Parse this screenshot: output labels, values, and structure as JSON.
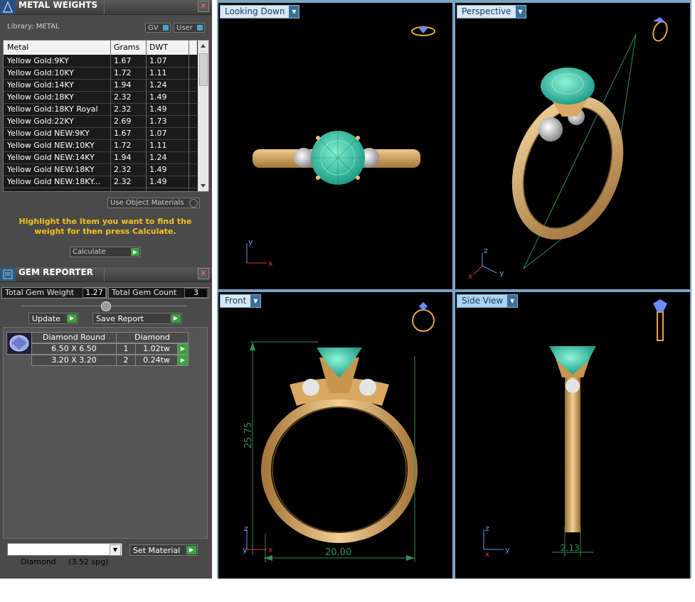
{
  "metal_panel": {
    "title": "METAL WEIGHTS",
    "library_label": "Library: METAL",
    "gv_label": "GV",
    "user_label": "User",
    "columns": [
      "Metal",
      "Grams",
      "DWT"
    ],
    "rows": [
      {
        "metal": "Yellow Gold:9KY",
        "grams": "1.67",
        "dwt": "1.07"
      },
      {
        "metal": "Yellow Gold:10KY",
        "grams": "1.72",
        "dwt": "1.11"
      },
      {
        "metal": "Yellow Gold:14KY",
        "grams": "1.94",
        "dwt": "1.24"
      },
      {
        "metal": "Yellow Gold:18KY",
        "grams": "2.32",
        "dwt": "1.49"
      },
      {
        "metal": "Yellow Gold:18KY Royal",
        "grams": "2.32",
        "dwt": "1.49"
      },
      {
        "metal": "Yellow Gold:22KY",
        "grams": "2.69",
        "dwt": "1.73"
      },
      {
        "metal": "Yellow Gold NEW:9KY",
        "grams": "1.67",
        "dwt": "1.07"
      },
      {
        "metal": "Yellow Gold NEW:10KY",
        "grams": "1.72",
        "dwt": "1.11"
      },
      {
        "metal": "Yellow Gold NEW:14KY",
        "grams": "1.94",
        "dwt": "1.24"
      },
      {
        "metal": "Yellow Gold NEW:18KY",
        "grams": "2.32",
        "dwt": "1.49"
      },
      {
        "metal": "Yellow Gold NEW:18KY...",
        "grams": "2.32",
        "dwt": "1.49"
      }
    ],
    "use_object_materials": "Use Object Materials",
    "hint": "Highlight the item you want to find the weight for then press Calculate.",
    "calculate_label": "Calculate"
  },
  "gem_panel": {
    "title": "GEM REPORTER",
    "total_weight_label": "Total Gem Weight",
    "total_weight_value": "1.27",
    "total_count_label": "Total Gem Count",
    "total_count_value": "3",
    "update_label": "Update",
    "save_report_label": "Save Report",
    "group_name": "Diamond Round",
    "group_material": "Diamond",
    "gems": [
      {
        "size": "6.50 X 6.50",
        "count": "1",
        "weight": "1.02tw"
      },
      {
        "size": "3.20 X 3.20",
        "count": "2",
        "weight": "0.24tw"
      }
    ],
    "material_select": "Diamond     (3.52 spg)",
    "set_material_label": "Set Material"
  },
  "viewports": {
    "top_left": "Looking Down",
    "top_right": "Perspective",
    "bottom_left": "Front",
    "bottom_right": "Side View"
  },
  "dimensions": {
    "front_height": "25.75",
    "front_width": "20.00",
    "side_width": "2.13"
  },
  "axes": {
    "x": "x",
    "y": "y",
    "z": "z"
  },
  "colors": {
    "gold": "#d9a862",
    "gem_green": "#3fd7b0",
    "dimension_line": "#2f8f5a",
    "axis_red": "#d83a3a",
    "axis_blue": "#5aa0e8",
    "hint_yellow": "#f6c21a",
    "viewport_label_bg": "#d6e8f5"
  }
}
